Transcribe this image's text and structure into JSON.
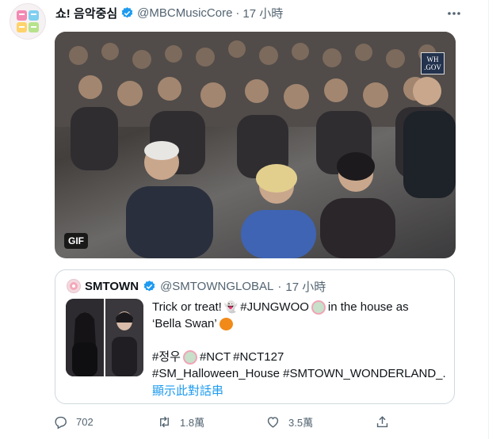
{
  "tweet": {
    "display_name": "쇼! 음악중심",
    "handle": "@MBCMusicCore",
    "dot": "·",
    "time": "17 小時",
    "media": {
      "gif_label": "GIF",
      "watermark_top": "WH",
      "watermark_bottom": ".GOV"
    },
    "quoted": {
      "display_name": "SMTOWN",
      "handle": "@SMTOWNGLOBAL",
      "dot": "·",
      "time": "17 小時",
      "text_line1a": "Trick or treat!",
      "text_line1b": "#JUNGWOO",
      "text_line1c": "in the house as",
      "text_line2": "‘Bella Swan’",
      "tag_jeongwoo": "#정우",
      "tag_nct": "#NCT",
      "tag_nct127": "#NCT127",
      "tags_line4": "#SM_Halloween_House #SMTOWN_WONDERLAND_...",
      "show_thread": "顯示此對話串"
    },
    "actions": {
      "reply_count": "702",
      "retweet_count": "1.8萬",
      "like_count": "3.5萬"
    },
    "colors": {
      "accent": "#1d9bf0",
      "text": "#0f1419",
      "secondary": "#536471",
      "border": "#cfd9de"
    }
  }
}
